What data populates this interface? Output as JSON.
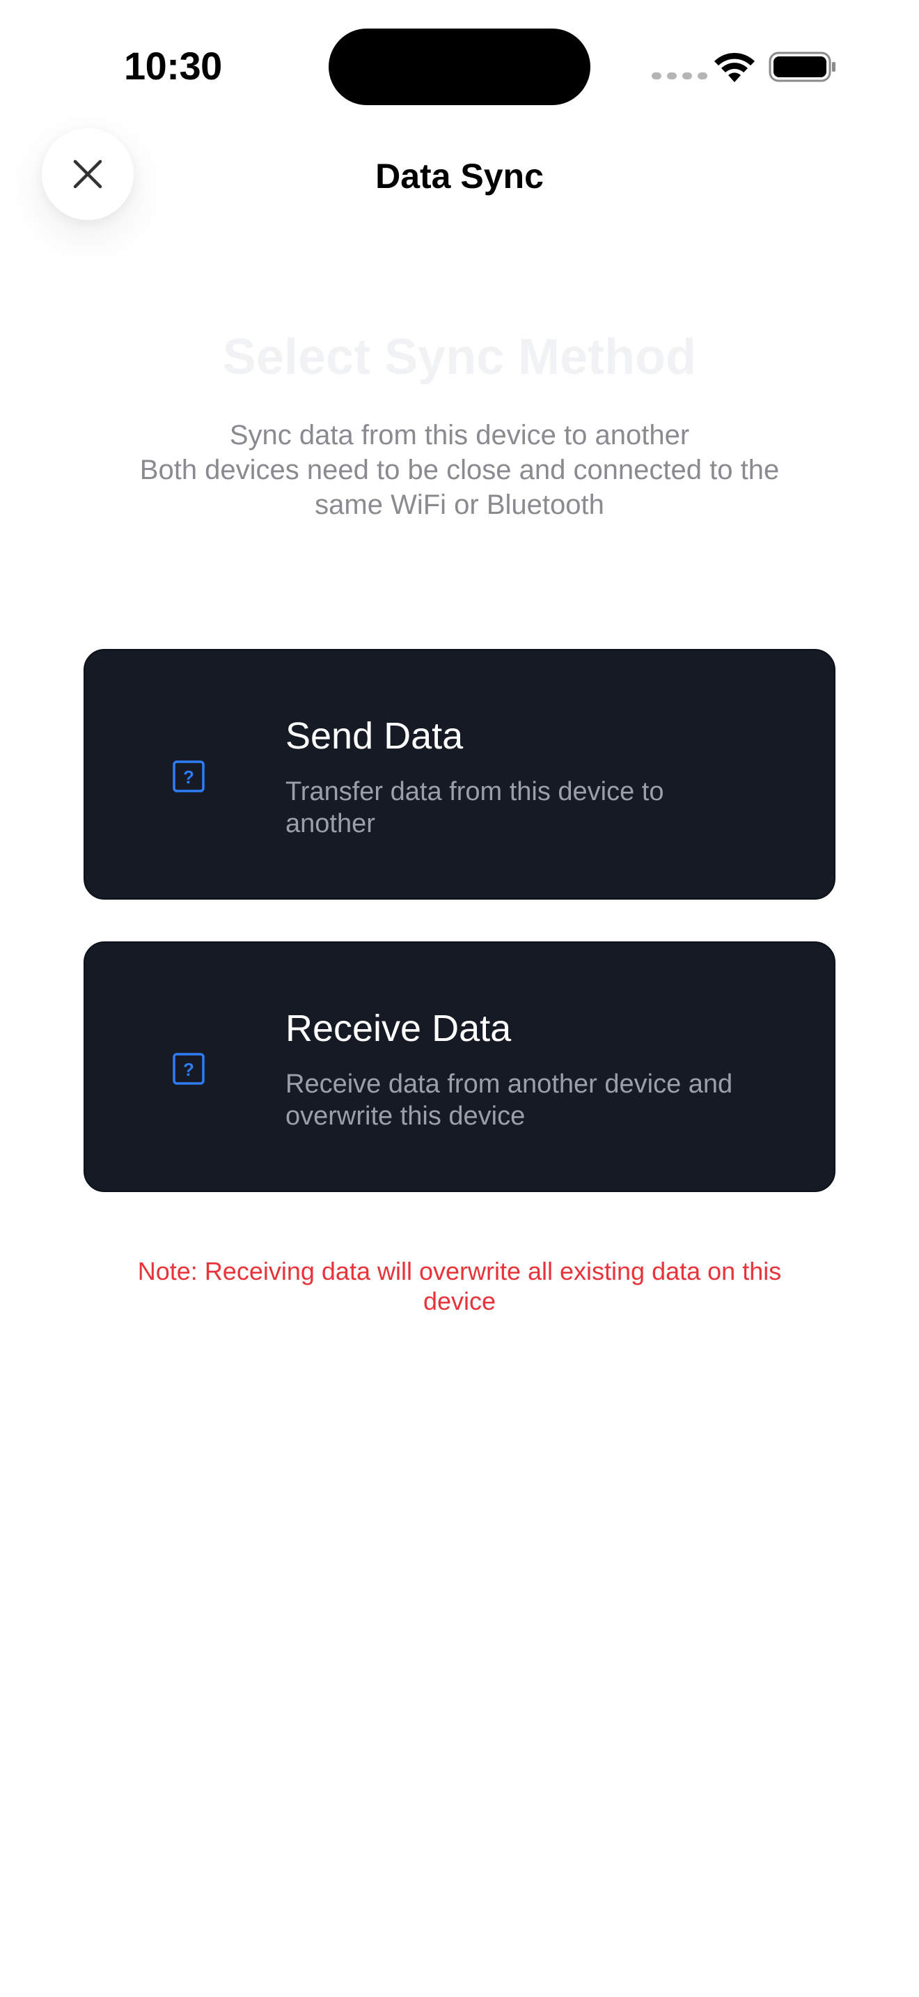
{
  "status_bar": {
    "time": "10:30"
  },
  "nav": {
    "title": "Data Sync",
    "close_icon": "close-icon"
  },
  "header": {
    "title": "Select Sync Method",
    "subtitle_lines": [
      "Sync data from this device to another",
      "Both devices need to be close and connected to the",
      "same WiFi or Bluetooth"
    ]
  },
  "options": [
    {
      "title": "Send Data",
      "description": "Transfer data from this device to another",
      "icon": "question-mark-icon"
    },
    {
      "title": "Receive Data",
      "description": "Receive data from another device and overwrite this device",
      "icon": "question-mark-icon"
    }
  ],
  "note": "Note: Receiving data will overwrite all existing data on this device",
  "colors": {
    "card_bg": "#151a24",
    "accent_icon": "#2f7cf6",
    "note": "#e8333a"
  }
}
